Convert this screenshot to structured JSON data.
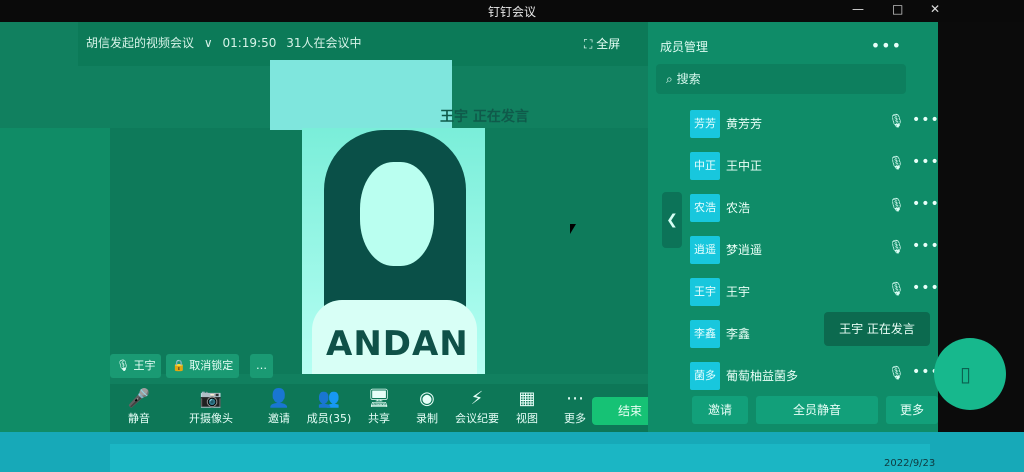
{
  "window": {
    "title": "钉钉会议",
    "controls": [
      "—",
      "□",
      "✕"
    ]
  },
  "meeting": {
    "host_title": "胡信发起的视频会议",
    "chevron": "∨",
    "elapsed": "01:19:50",
    "participants_text": "31人在会议中",
    "fullscreen": "全屏",
    "speaker_banner": "王宇 正在发言",
    "shirt_text": "ANDAN"
  },
  "video_chips": [
    {
      "label": "王宇",
      "icon": "mic-icon"
    },
    {
      "label": "取消锁定",
      "icon": "lock-icon"
    },
    {
      "label": "…"
    }
  ],
  "toolbar": {
    "buttons": [
      {
        "label": "静音",
        "icon": "mic-icon"
      },
      {
        "label": "开摄像头",
        "icon": "camera-icon"
      },
      {
        "label": "邀请",
        "icon": "invite-icon"
      },
      {
        "label": "成员(35)",
        "icon": "members-icon"
      },
      {
        "label": "共享",
        "icon": "share-icon"
      },
      {
        "label": "录制",
        "icon": "record-icon"
      },
      {
        "label": "会议纪要",
        "icon": "notes-icon"
      },
      {
        "label": "视图",
        "icon": "grid-icon"
      },
      {
        "label": "更多",
        "icon": "more-icon"
      }
    ],
    "end_label": "结束"
  },
  "panel": {
    "header": "成员管理",
    "menu": "•••",
    "search_placeholder": "搜索",
    "members": [
      {
        "avatar": "芳芳",
        "name": "黄芳芳"
      },
      {
        "avatar": "中正",
        "name": "王中正"
      },
      {
        "avatar": "农浩",
        "name": "农浩"
      },
      {
        "avatar": "逍遥",
        "name": "梦逍遥"
      },
      {
        "avatar": "王宇",
        "name": "王宇"
      },
      {
        "avatar": "李鑫",
        "name": "李鑫"
      },
      {
        "avatar": "菌多",
        "name": "葡萄柚益菌多"
      }
    ],
    "speaking_toast": "王宇 正在发言",
    "bottom_buttons": [
      "邀请",
      "全员静音",
      "更多"
    ]
  },
  "taskbar": {
    "date": "2022/9/23"
  }
}
